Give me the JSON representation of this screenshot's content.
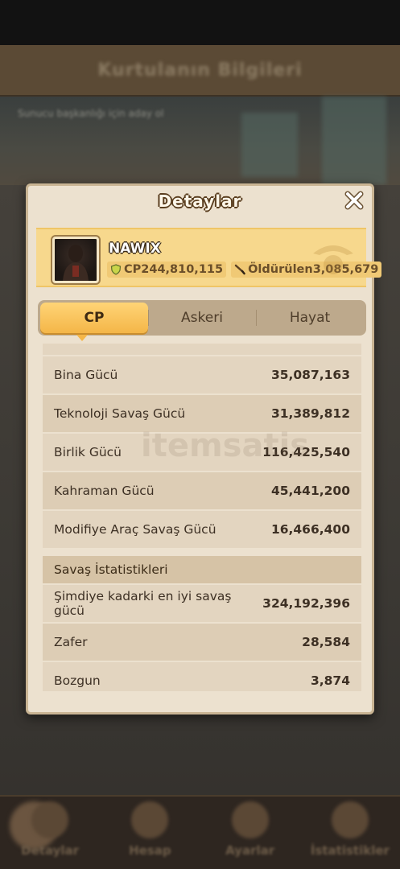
{
  "background": {
    "header_title": "Kurtulanın Bilgileri",
    "scene_text": "Sunucu başkanlığı için aday ol",
    "nav": [
      {
        "label": "Detaylar",
        "icon": "details-icon"
      },
      {
        "label": "Hesap",
        "icon": "account-icon"
      },
      {
        "label": "Ayarlar",
        "icon": "settings-icon"
      },
      {
        "label": "İstatistikler",
        "icon": "stats-icon"
      }
    ]
  },
  "modal": {
    "title": "Detaylar",
    "player": {
      "name": "NAWIX",
      "cp_text": "CP244,810,115",
      "kills_text": "Öldürülen3,085,679"
    },
    "tabs": [
      {
        "label": "CP",
        "active": true
      },
      {
        "label": "Askeri",
        "active": false
      },
      {
        "label": "Hayat",
        "active": false
      }
    ],
    "power_rows": [
      {
        "label": "Bina Gücü",
        "value": "35,087,163"
      },
      {
        "label": "Teknoloji Savaş Gücü",
        "value": "31,389,812"
      },
      {
        "label": "Birlik Gücü",
        "value": "116,425,540"
      },
      {
        "label": "Kahraman Gücü",
        "value": "45,441,200"
      },
      {
        "label": "Modifiye Araç Savaş Gücü",
        "value": "16,466,400"
      }
    ],
    "battle_section": "Savaş İstatistikleri",
    "battle_rows": [
      {
        "label": "Şimdiye kadarki en iyi savaş gücü",
        "value": "324,192,396"
      },
      {
        "label": "Zafer",
        "value": "28,584"
      },
      {
        "label": "Bozgun",
        "value": "3,874"
      }
    ],
    "watermark": "itemsatis"
  },
  "colors": {
    "panel": "#ece1cf",
    "banner": "#f7d88d",
    "tab_active": "#f4b648",
    "text_dark": "#3d3024"
  }
}
